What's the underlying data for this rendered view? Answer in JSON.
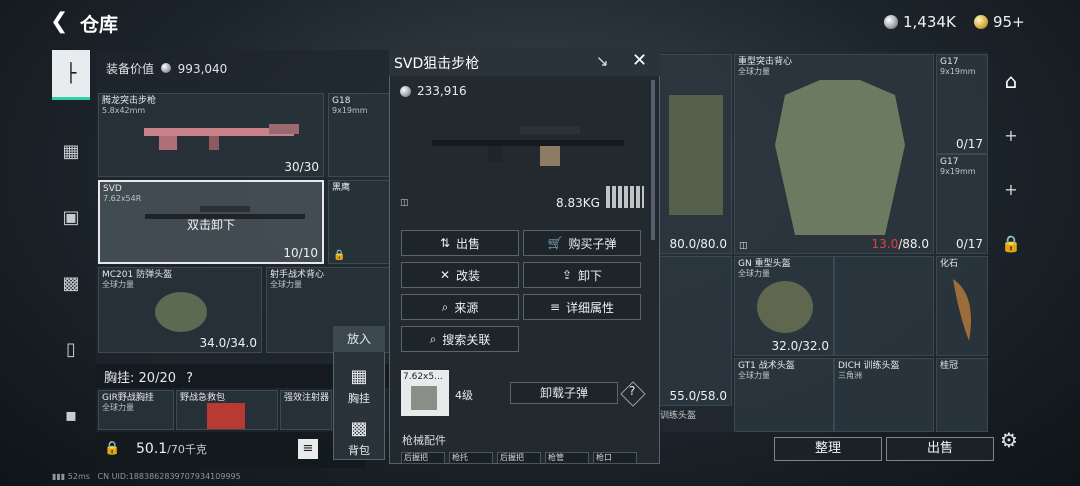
{
  "header": {
    "title": "仓库",
    "silver_amount": "1,434K",
    "gold_amount": "95+"
  },
  "left_panel": {
    "equip_value_label": "装备价值",
    "equip_value": "993,040",
    "items": [
      {
        "name": "腾龙突击步枪",
        "sub": "5.8x42mm",
        "count": "30/30"
      },
      {
        "name": "G18",
        "sub": "9x19mm",
        "count": ""
      },
      {
        "name": "SVD",
        "sub": "7.62x54R",
        "count": "10/10",
        "hint": "双击卸下"
      },
      {
        "name": "黑鹰",
        "sub": "",
        "count": ""
      },
      {
        "name": "MC201 防弹头盔",
        "sub": "全球力量",
        "count": "34.0/34.0"
      },
      {
        "name": "射手战术背心",
        "sub": "全球力量",
        "count": ""
      }
    ],
    "chest_label": "胸挂:",
    "chest_count": "20/20",
    "chest_help": "?",
    "chest_items": [
      {
        "name": "GIR野战胸挂",
        "sub": "全球力量"
      },
      {
        "name": "野战急救包",
        "sub": ""
      },
      {
        "name": "强效注射器",
        "sub": ""
      }
    ],
    "weight": "50.1",
    "weight_max": "/70千克",
    "putin": {
      "title": "放入",
      "slots": [
        "胸挂",
        "背包"
      ]
    }
  },
  "popup": {
    "title": "SVD狙击步枪",
    "price": "233,916",
    "weight": "8.83KG",
    "actions": [
      {
        "icon": "⇅",
        "label": "出售"
      },
      {
        "icon": "🛒",
        "label": "购买子弹"
      },
      {
        "icon": "✕",
        "label": "改装"
      },
      {
        "icon": "⇪",
        "label": "卸下"
      },
      {
        "icon": "⌕",
        "label": "来源"
      },
      {
        "icon": "≡",
        "label": "详细属性"
      },
      {
        "icon": "⌕",
        "label": "搜索关联"
      }
    ],
    "ammo_name": "7.62x5...",
    "ammo_level": "4级",
    "unload_ammo": "卸载子弹",
    "help": "?",
    "attachments_label": "枪械配件",
    "attachments": [
      "后握把",
      "枪托",
      "后握把",
      "枪管",
      "枪口"
    ]
  },
  "right_panel": {
    "items": [
      {
        "name": "",
        "sub": "",
        "count": "80.0/80.0"
      },
      {
        "name": "重型突击背心",
        "sub": "全球力量",
        "count": "13.0/88.0",
        "count_red": "13.0"
      },
      {
        "name": "G17",
        "sub": "9x19mm",
        "count": "0/17"
      },
      {
        "name": "G17",
        "sub": "9x19mm",
        "count": "0/17"
      },
      {
        "name": "",
        "sub": "",
        "count": "55.0/58.0"
      },
      {
        "name": "GN 重型头盔",
        "sub": "全球力量",
        "count": "32.0/32.0"
      },
      {
        "name": "化石",
        "sub": "",
        "count": ""
      },
      {
        "name": "GT1 战术头盔",
        "sub": "全球力量",
        "count": ""
      },
      {
        "name": "DICH 训练头盔",
        "sub": "三角洲",
        "count": ""
      },
      {
        "name": "桂冠",
        "sub": "",
        "count": ""
      },
      {
        "name": "训练头盔",
        "sub": "",
        "count": ""
      }
    ],
    "organize": "整理",
    "sell": "出售"
  },
  "footer": {
    "ping": "52ms",
    "uid": "CN UID:1883862839707934109995"
  },
  "colors": {
    "accent": "#2fd0a9",
    "damage_red": "#e04040"
  }
}
